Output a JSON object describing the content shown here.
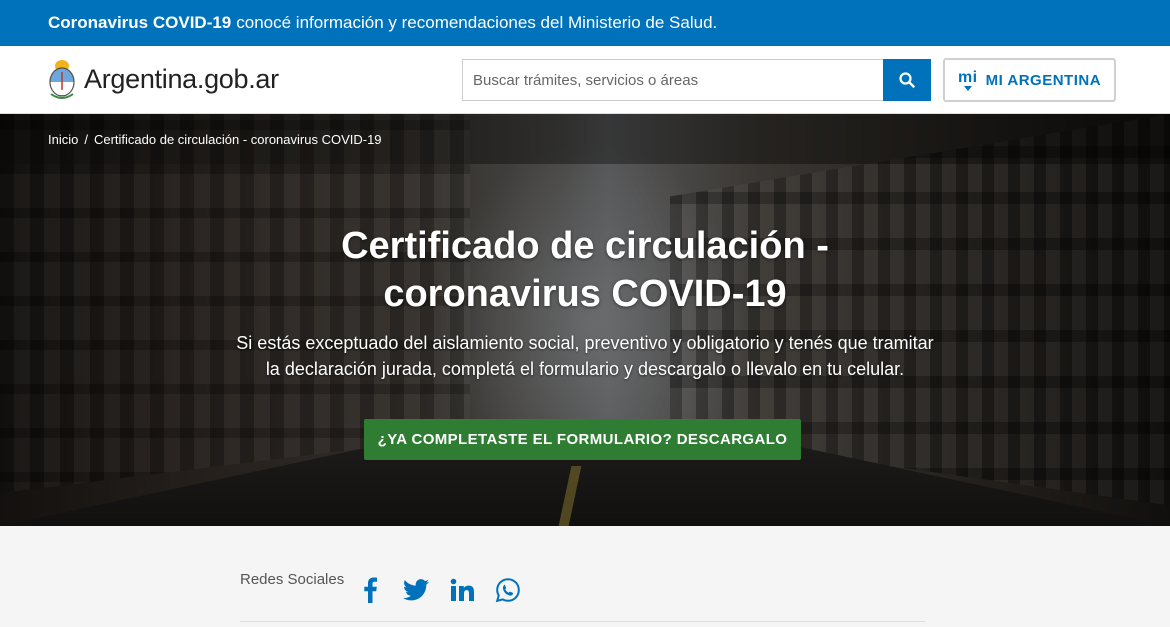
{
  "banner": {
    "bold": "Coronavirus COVID-19",
    "text": "conocé información y recomendaciones del Ministerio de Salud."
  },
  "header": {
    "brand": "Argentina.gob.ar",
    "search_placeholder": "Buscar trámites, servicios o áreas",
    "mi_logo": "mi",
    "mi_label": "MI ARGENTINA"
  },
  "breadcrumb": {
    "home": "Inicio",
    "separator": "/",
    "current": "Certificado de circulación - coronavirus COVID-19"
  },
  "hero": {
    "title_line1": "Certificado de circulación -",
    "title_line2": "coronavirus COVID-19",
    "description": "Si estás exceptuado del aislamiento social, preventivo y obligatorio y tenés que tramitar la declaración jurada, completá el formulario y descargalo o llevalo en tu celular.",
    "cta": "¿YA COMPLETASTE EL FORMULARIO? DESCARGALO"
  },
  "social": {
    "label": "Redes Sociales",
    "icons": [
      "facebook-icon",
      "twitter-icon",
      "linkedin-icon",
      "whatsapp-icon"
    ]
  },
  "colors": {
    "primary": "#0072bb",
    "cta_green": "#2e7d32"
  }
}
